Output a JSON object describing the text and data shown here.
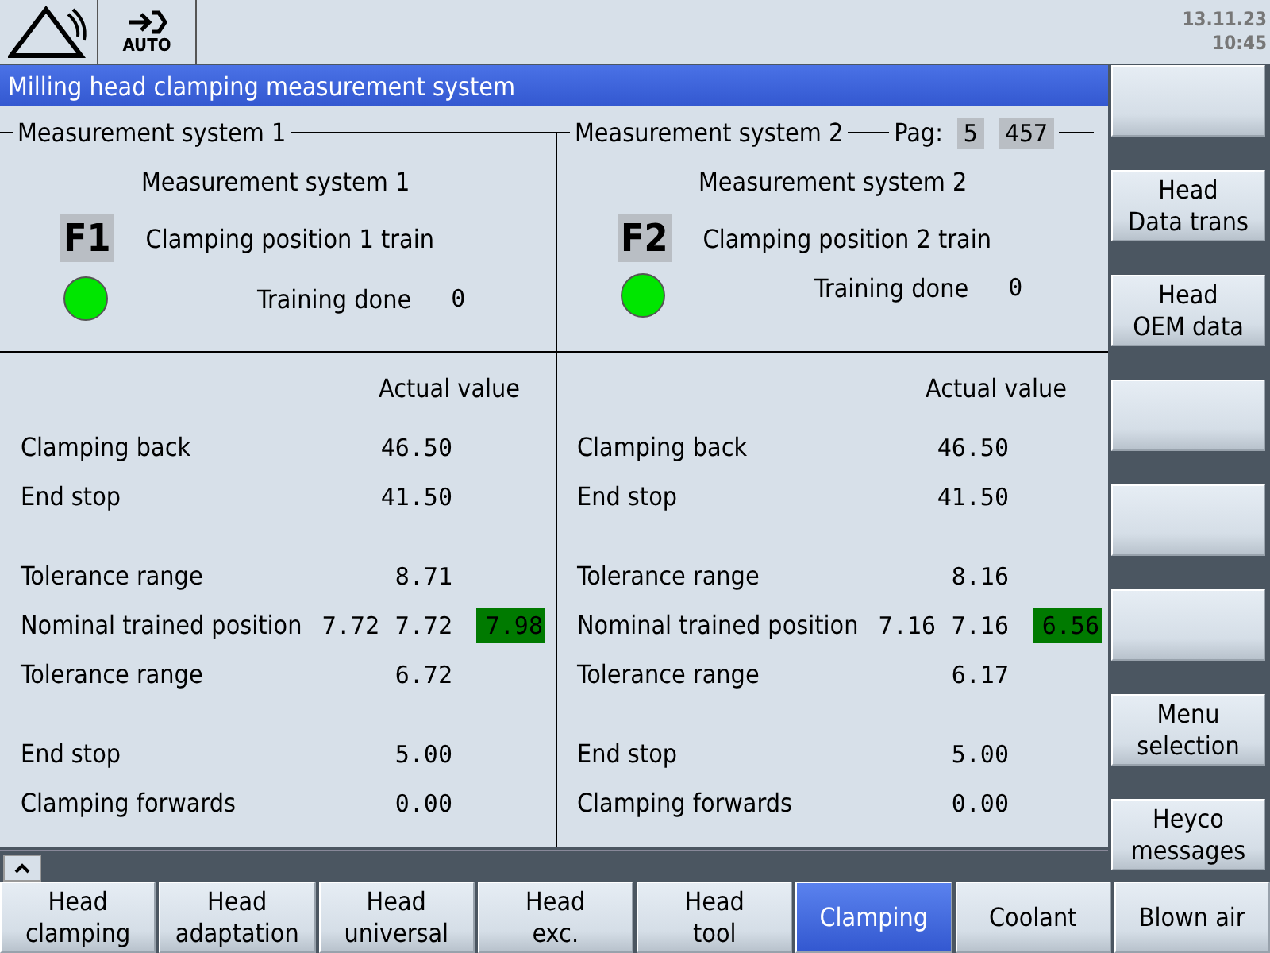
{
  "header": {
    "mode": "AUTO",
    "date": "13.11.23",
    "time": "10:45"
  },
  "title": "Milling head clamping measurement system",
  "pager": {
    "label": "Pag:",
    "current": "5",
    "total": "457"
  },
  "systems": [
    {
      "frame_title": "Measurement system 1",
      "heading": "Measurement system 1",
      "f_key": "F1",
      "train_label": "Clamping position 1 train",
      "lamp_on": true,
      "training_label": "Training done",
      "training_value": "0",
      "actual_header": "Actual value",
      "groups": [
        [
          {
            "label": "Clamping back",
            "actual": "46.50"
          },
          {
            "label": "End stop",
            "actual": "41.50"
          }
        ],
        [
          {
            "label": "Tolerance range",
            "actual": "8.71"
          },
          {
            "label": "Nominal trained position",
            "set": "7.72",
            "actual": "7.72",
            "trained": {
              "text": "7.98",
              "ok": true
            }
          },
          {
            "label": "Tolerance range",
            "actual": "6.72"
          }
        ],
        [
          {
            "label": "End stop",
            "actual": "5.00"
          },
          {
            "label": "Clamping forwards",
            "actual": "0.00"
          }
        ]
      ]
    },
    {
      "frame_title": "Measurement system 2",
      "heading": "Measurement system 2",
      "f_key": "F2",
      "train_label": "Clamping position 2 train",
      "lamp_on": true,
      "training_label": "Training done",
      "training_value": "0",
      "actual_header": "Actual value",
      "groups": [
        [
          {
            "label": "Clamping back",
            "actual": "46.50"
          },
          {
            "label": "End stop",
            "actual": "41.50"
          }
        ],
        [
          {
            "label": "Tolerance range",
            "actual": "8.16"
          },
          {
            "label": "Nominal trained position",
            "set": "7.16",
            "actual": "7.16",
            "trained": {
              "text": "6.56",
              "ok": true
            }
          },
          {
            "label": "Tolerance range",
            "actual": "6.17"
          }
        ],
        [
          {
            "label": "End stop",
            "actual": "5.00"
          },
          {
            "label": "Clamping forwards",
            "actual": "0.00"
          }
        ]
      ]
    }
  ],
  "vertical_softkeys": [
    {
      "kind": "blank"
    },
    {
      "kind": "text",
      "label": "Head\nData trans"
    },
    {
      "kind": "text",
      "label": "Head\nOEM data"
    },
    {
      "kind": "blank"
    },
    {
      "kind": "blank"
    },
    {
      "kind": "blank"
    },
    {
      "kind": "text",
      "label": "Menu\nselection"
    },
    {
      "kind": "text",
      "label": "Heyco\nmessages"
    }
  ],
  "horizontal_softkeys": [
    {
      "label": "Head\nclamping",
      "selected": false
    },
    {
      "label": "Head\nadaptation",
      "selected": false
    },
    {
      "label": "Head\nuniversal",
      "selected": false
    },
    {
      "label": "Head\nexc.",
      "selected": false
    },
    {
      "label": "Head\ntool",
      "selected": false
    },
    {
      "label": "Clamping",
      "selected": true
    },
    {
      "label": "Coolant",
      "selected": false
    },
    {
      "label": "Blown air",
      "selected": false
    }
  ]
}
